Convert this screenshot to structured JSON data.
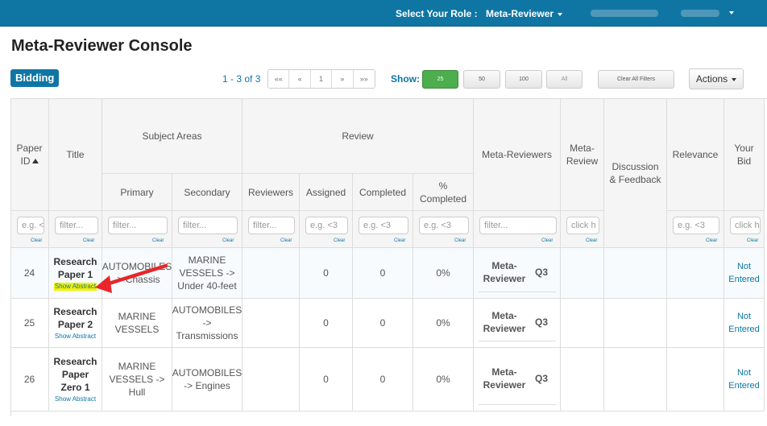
{
  "topbar": {
    "role_label": "Select Your Role :",
    "role_value": "Meta-Reviewer"
  },
  "page_title": "Meta-Reviewer Console",
  "tab_label": "Bidding",
  "pagination": {
    "range": "1 - 3 of 3",
    "buttons": [
      "««",
      "«",
      "1",
      "»",
      "»»"
    ]
  },
  "show": {
    "label": "Show:",
    "options": [
      "25",
      "50",
      "100",
      "All"
    ],
    "selected": "25"
  },
  "clear_filters_label": "Clear All Filters",
  "actions_label": "Actions",
  "table": {
    "headers": {
      "paper_id": "Paper ID",
      "title": "Title",
      "subject_areas": "Subject Areas",
      "primary": "Primary",
      "secondary": "Secondary",
      "review": "Review",
      "reviewers": "Reviewers",
      "assigned": "Assigned",
      "completed": "Completed",
      "pct_completed": "% Completed",
      "meta_reviewers": "Meta-Reviewers",
      "meta_review": "Meta-Review",
      "discussion": "Discussion & Feedback",
      "relevance": "Relevance",
      "your_bid": "Your Bid"
    },
    "filters": {
      "paper_id": "e.g. <",
      "title": "filter...",
      "primary": "filter...",
      "secondary": "filter...",
      "reviewers": "filter...",
      "assigned": "e.g. <3",
      "completed": "e.g. <3",
      "pct_completed": "e.g. <3",
      "meta_reviewers": "filter...",
      "meta_review": "click h",
      "relevance": "e.g. <3",
      "your_bid": "click h"
    },
    "clear_label": "Clear",
    "rows": [
      {
        "id": "24",
        "title": "Research Paper 1",
        "abstract": "Show Abstract",
        "primary": "AUTOMOBILES -> Chassis",
        "secondary": "MARINE VESSELS -> Under 40-feet",
        "reviewers": "",
        "assigned": "0",
        "completed": "0",
        "pct": "0%",
        "meta_reviewer": "Meta-Reviewer",
        "meta_q": "Q3",
        "bid": "Not Entered"
      },
      {
        "id": "25",
        "title": "Research Paper 2",
        "abstract": "Show Abstract",
        "primary": "MARINE VESSELS",
        "secondary": "AUTOMOBILES -> Transmissions",
        "reviewers": "",
        "assigned": "0",
        "completed": "0",
        "pct": "0%",
        "meta_reviewer": "Meta-Reviewer",
        "meta_q": "Q3",
        "bid": "Not Entered"
      },
      {
        "id": "26",
        "title": "Research Paper Zero 1",
        "abstract": "Show Abstract",
        "primary": "MARINE VESSELS -> Hull",
        "secondary": "AUTOMOBILES -> Engines",
        "reviewers": "",
        "assigned": "0",
        "completed": "0",
        "pct": "0%",
        "meta_reviewer": "Meta-Reviewer",
        "meta_q": "Q3",
        "bid": "Not Entered"
      }
    ]
  },
  "annotation": {
    "arrow_color": "#e8262b",
    "highlight_color": "#f2f200"
  }
}
